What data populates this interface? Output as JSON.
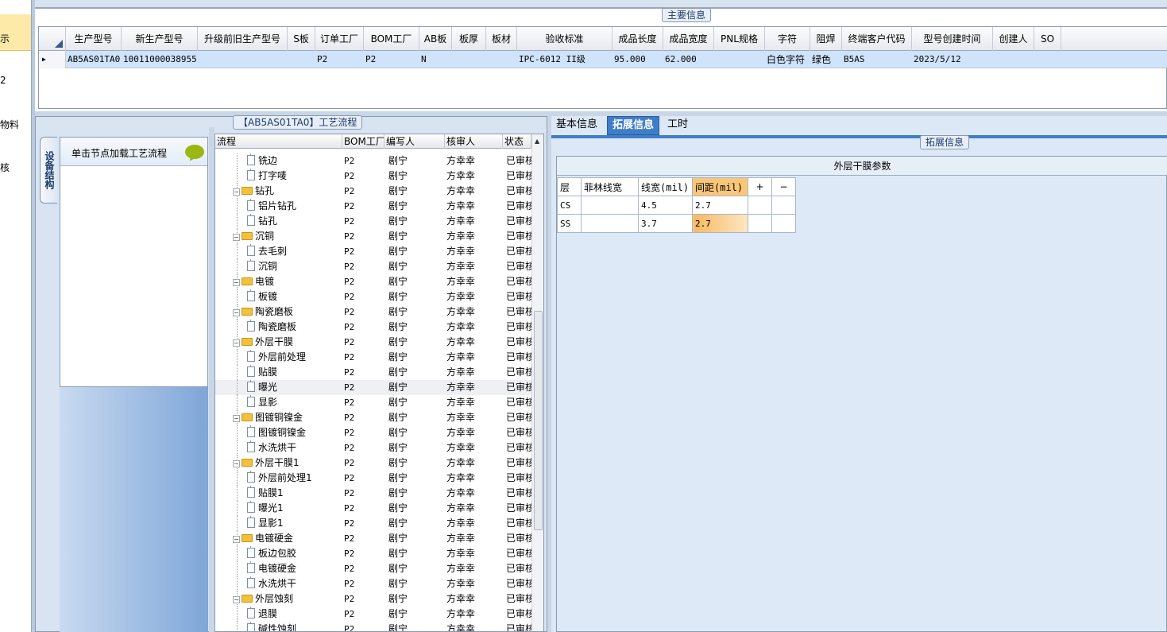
{
  "leftnav": {
    "items": [
      "示",
      "2",
      "物料",
      "核"
    ]
  },
  "main_info": {
    "legend": "主要信息",
    "columns": [
      "生产型号",
      "新生产型号",
      "升级前旧生产型号",
      "S板",
      "订单工厂",
      "BOM工厂",
      "AB板",
      "板厚",
      "板材",
      "验收标准",
      "成品长度",
      "成品宽度",
      "PNL规格",
      "字符",
      "阻焊",
      "终端客户代码",
      "型号创建时间",
      "创建人",
      "SO"
    ],
    "row": {
      "model": "AB5AS01TA0",
      "new_model": "10011000038955",
      "old_model": "",
      "s_board": "",
      "order_factory": "P2",
      "bom_factory": "P2",
      "ab_board": "N",
      "thickness": "",
      "material": "",
      "standard": "IPC-6012 II级",
      "length": "95.000",
      "width": "62.000",
      "pnl": "",
      "char": "白色字符",
      "solder": "绿色",
      "customer_code": "B5AS",
      "created": "2023/5/12",
      "creator": "",
      "so": ""
    }
  },
  "process": {
    "legend": "【AB5AS01TA0】工艺流程",
    "vertical_tab": "设备结构",
    "hint": "单击节点加载工艺流程",
    "columns": [
      "流程",
      "BOM工厂",
      "编写人",
      "核审人",
      "状态"
    ],
    "rows": [
      {
        "name": "铣边",
        "level": 2,
        "type": "doc",
        "bom": "P2",
        "writer": "剧宁",
        "reviewer": "方幸幸",
        "status": "已审核"
      },
      {
        "name": "打字唛",
        "level": 2,
        "type": "doc",
        "bom": "P2",
        "writer": "剧宁",
        "reviewer": "方幸幸",
        "status": "已审核"
      },
      {
        "name": "钻孔",
        "level": 1,
        "type": "folder",
        "bom": "P2",
        "writer": "剧宁",
        "reviewer": "方幸幸",
        "status": "已审核"
      },
      {
        "name": "铝片钻孔",
        "level": 2,
        "type": "doc",
        "bom": "P2",
        "writer": "剧宁",
        "reviewer": "方幸幸",
        "status": "已审核"
      },
      {
        "name": "钻孔",
        "level": 2,
        "type": "doc",
        "bom": "P2",
        "writer": "剧宁",
        "reviewer": "方幸幸",
        "status": "已审核"
      },
      {
        "name": "沉铜",
        "level": 1,
        "type": "folder",
        "bom": "P2",
        "writer": "剧宁",
        "reviewer": "方幸幸",
        "status": "已审核"
      },
      {
        "name": "去毛刺",
        "level": 2,
        "type": "doc",
        "bom": "P2",
        "writer": "剧宁",
        "reviewer": "方幸幸",
        "status": "已审核"
      },
      {
        "name": "沉铜",
        "level": 2,
        "type": "doc",
        "bom": "P2",
        "writer": "剧宁",
        "reviewer": "方幸幸",
        "status": "已审核"
      },
      {
        "name": "电镀",
        "level": 1,
        "type": "folder",
        "bom": "P2",
        "writer": "剧宁",
        "reviewer": "方幸幸",
        "status": "已审核"
      },
      {
        "name": "板镀",
        "level": 2,
        "type": "doc",
        "bom": "P2",
        "writer": "剧宁",
        "reviewer": "方幸幸",
        "status": "已审核"
      },
      {
        "name": "陶瓷磨板",
        "level": 1,
        "type": "folder",
        "bom": "P2",
        "writer": "剧宁",
        "reviewer": "方幸幸",
        "status": "已审核"
      },
      {
        "name": "陶瓷磨板",
        "level": 2,
        "type": "doc",
        "bom": "P2",
        "writer": "剧宁",
        "reviewer": "方幸幸",
        "status": "已审核"
      },
      {
        "name": "外层干膜",
        "level": 1,
        "type": "folder",
        "bom": "P2",
        "writer": "剧宁",
        "reviewer": "方幸幸",
        "status": "已审核"
      },
      {
        "name": "外层前处理",
        "level": 2,
        "type": "doc",
        "bom": "P2",
        "writer": "剧宁",
        "reviewer": "方幸幸",
        "status": "已审核"
      },
      {
        "name": "贴膜",
        "level": 2,
        "type": "doc",
        "bom": "P2",
        "writer": "剧宁",
        "reviewer": "方幸幸",
        "status": "已审核"
      },
      {
        "name": "曝光",
        "level": 2,
        "type": "doc",
        "bom": "P2",
        "writer": "剧宁",
        "reviewer": "方幸幸",
        "status": "已审核",
        "selected": true
      },
      {
        "name": "显影",
        "level": 2,
        "type": "doc",
        "bom": "P2",
        "writer": "剧宁",
        "reviewer": "方幸幸",
        "status": "已审核"
      },
      {
        "name": "图镀铜镍金",
        "level": 1,
        "type": "folder",
        "bom": "P2",
        "writer": "剧宁",
        "reviewer": "方幸幸",
        "status": "已审核"
      },
      {
        "name": "图镀铜镍金",
        "level": 2,
        "type": "doc",
        "bom": "P2",
        "writer": "剧宁",
        "reviewer": "方幸幸",
        "status": "已审核"
      },
      {
        "name": "水洗烘干",
        "level": 2,
        "type": "doc",
        "bom": "P2",
        "writer": "剧宁",
        "reviewer": "方幸幸",
        "status": "已审核"
      },
      {
        "name": "外层干膜1",
        "level": 1,
        "type": "folder",
        "bom": "P2",
        "writer": "剧宁",
        "reviewer": "方幸幸",
        "status": "已审核"
      },
      {
        "name": "外层前处理1",
        "level": 2,
        "type": "doc",
        "bom": "P2",
        "writer": "剧宁",
        "reviewer": "方幸幸",
        "status": "已审核"
      },
      {
        "name": "贴膜1",
        "level": 2,
        "type": "doc",
        "bom": "P2",
        "writer": "剧宁",
        "reviewer": "方幸幸",
        "status": "已审核"
      },
      {
        "name": "曝光1",
        "level": 2,
        "type": "doc",
        "bom": "P2",
        "writer": "剧宁",
        "reviewer": "方幸幸",
        "status": "已审核"
      },
      {
        "name": "显影1",
        "level": 2,
        "type": "doc",
        "bom": "P2",
        "writer": "剧宁",
        "reviewer": "方幸幸",
        "status": "已审核"
      },
      {
        "name": "电镀硬金",
        "level": 1,
        "type": "folder",
        "bom": "P2",
        "writer": "剧宁",
        "reviewer": "方幸幸",
        "status": "已审核"
      },
      {
        "name": "板边包胶",
        "level": 2,
        "type": "doc",
        "bom": "P2",
        "writer": "剧宁",
        "reviewer": "方幸幸",
        "status": "已审核"
      },
      {
        "name": "电镀硬金",
        "level": 2,
        "type": "doc",
        "bom": "P2",
        "writer": "剧宁",
        "reviewer": "方幸幸",
        "status": "已审核"
      },
      {
        "name": "水洗烘干",
        "level": 2,
        "type": "doc",
        "bom": "P2",
        "writer": "剧宁",
        "reviewer": "方幸幸",
        "status": "已审核"
      },
      {
        "name": "外层蚀刻",
        "level": 1,
        "type": "folder",
        "bom": "P2",
        "writer": "剧宁",
        "reviewer": "方幸幸",
        "status": "已审核"
      },
      {
        "name": "退膜",
        "level": 2,
        "type": "doc",
        "bom": "P2",
        "writer": "剧宁",
        "reviewer": "方幸幸",
        "status": "已审核"
      },
      {
        "name": "碱性蚀刻",
        "level": 2,
        "type": "doc",
        "bom": "P2",
        "writer": "剧宁",
        "reviewer": "方幸幸",
        "status": "已审核"
      }
    ]
  },
  "tabs": [
    "基本信息",
    "拓展信息",
    "工时"
  ],
  "active_tab": 1,
  "ext": {
    "legend": "拓展信息",
    "title": "外层干膜参数",
    "columns": [
      "层",
      "菲林线宽",
      "线宽(mil)",
      "间距(mil)",
      "+",
      "−"
    ],
    "rows": [
      {
        "layer": "CS",
        "film_width": "",
        "line_width": "4.5",
        "spacing": "2.7"
      },
      {
        "layer": "SS",
        "film_width": "",
        "line_width": "3.7",
        "spacing": "2.7"
      }
    ]
  }
}
